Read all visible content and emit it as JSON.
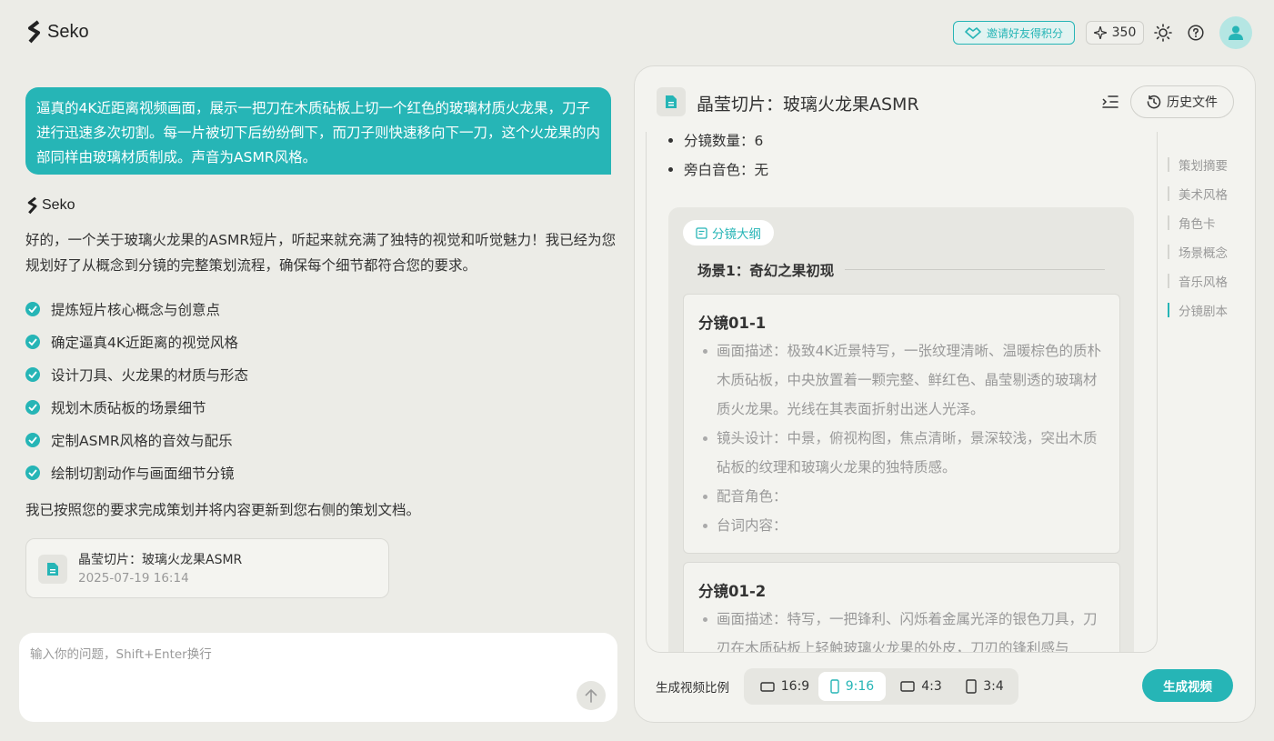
{
  "app": {
    "name": "Seko"
  },
  "header": {
    "invite_label": "邀请好友得积分",
    "credits": "350"
  },
  "chat": {
    "user_message": "逼真的4K近距离视频画面，展示一把刀在木质砧板上切一个红色的玻璃材质火龙果，刀子进行迅速多次切割。每一片被切下后纷纷倒下，而刀子则快速移向下一刀，这个火龙果的内部同样由玻璃材质制成。声音为ASMR风格。",
    "bot_name": "Seko",
    "bot_intro": "好的，一个关于玻璃火龙果的ASMR短片，听起来就充满了独特的视觉和听觉魅力！我已经为您规划好了从概念到分镜的完整策划流程，确保每个细节都符合您的要求。",
    "checklist": [
      "提炼短片核心概念与创意点",
      "确定逼真4K近距离的视觉风格",
      "设计刀具、火龙果的材质与形态",
      "规划木质砧板的场景细节",
      "定制ASMR风格的音效与配乐",
      "绘制切割动作与画面细节分镜"
    ],
    "done_text": "我已按照您的要求完成策划并将内容更新到您右侧的策划文档。",
    "doc_card": {
      "title": "晶莹切片：玻璃火龙果ASMR",
      "date": "2025-07-19 16:14"
    },
    "input_placeholder": "输入你的问题，Shift+Enter换行"
  },
  "panel": {
    "title": "晶莹切片：玻璃火龙果ASMR",
    "history_label": "历史文件",
    "meta": [
      "分镜数量：6",
      "旁白音色：无"
    ],
    "outline_tag": "分镜大纲",
    "scene_title": "场景1：奇幻之果初现",
    "shots": [
      {
        "title": "分镜01-1",
        "items": [
          "画面描述：极致4K近景特写，一张纹理清晰、温暖棕色的质朴木质砧板，中央放置着一颗完整、鲜红色、晶莹剔透的玻璃材质火龙果。光线在其表面折射出迷人光泽。",
          "镜头设计：中景，俯视构图，焦点清晰，景深较浅，突出木质砧板的纹理和玻璃火龙果的独特质感。",
          "配音角色：",
          "台词内容："
        ]
      },
      {
        "title": "分镜01-2",
        "items": [
          "画面描述：特写，一把锋利、闪烁着金属光泽的银色刀具，刀刃在木质砧板上轻触玻璃火龙果的外皮，刀刃的锋利感与"
        ]
      }
    ],
    "toc": [
      "策划摘要",
      "美术风格",
      "角色卡",
      "场景概念",
      "音乐风格",
      "分镜剧本"
    ],
    "ratio_label": "生成视频比例",
    "ratios": [
      "16:9",
      "9:16",
      "4:3",
      "3:4"
    ],
    "selected_ratio": "9:16",
    "generate_label": "生成视频"
  },
  "colors": {
    "accent": "#26b5b6",
    "background": "#ecece7",
    "panel": "#f3f3ef"
  }
}
